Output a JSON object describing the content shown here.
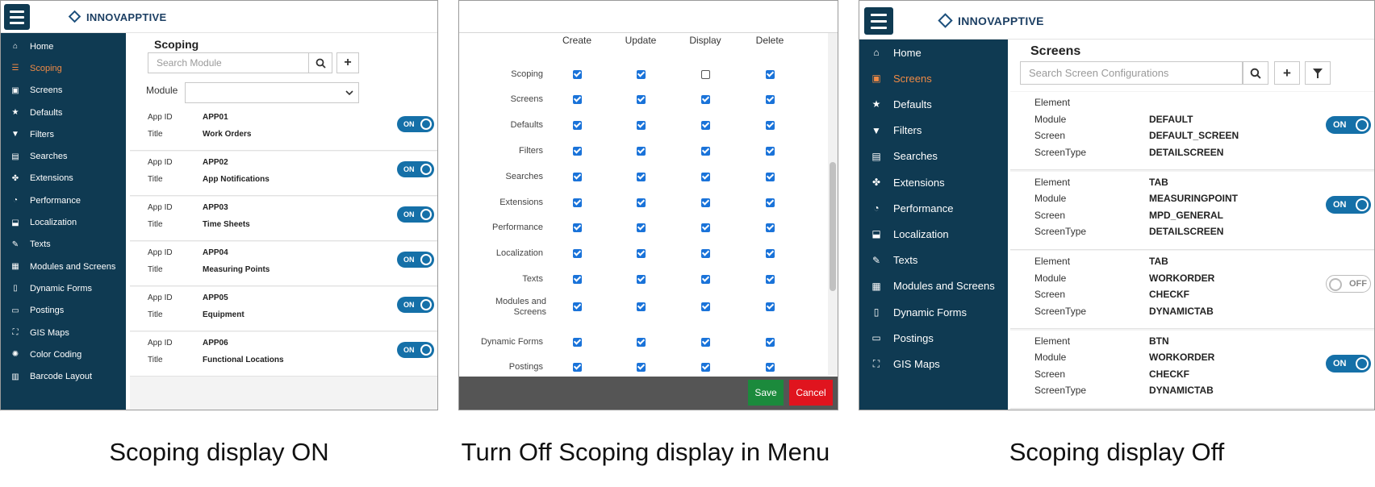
{
  "brand": "INNOVAPPTIVE",
  "colors": {
    "sidebar": "#0f3a52",
    "active": "#f08a45",
    "toggle_on": "#1570a8",
    "save": "#1b8a3c",
    "cancel": "#e0141e",
    "checkbox": "#1a73d9"
  },
  "left": {
    "nav": [
      {
        "icon": "home-icon",
        "glyph": "⌂",
        "label": "Home"
      },
      {
        "icon": "list-icon",
        "glyph": "☰",
        "label": "Scoping"
      },
      {
        "icon": "screen-icon",
        "glyph": "▣",
        "label": "Screens"
      },
      {
        "icon": "star-icon",
        "glyph": "★",
        "label": "Defaults"
      },
      {
        "icon": "filter-icon",
        "glyph": "▼",
        "label": "Filters"
      },
      {
        "icon": "search-box-icon",
        "glyph": "▤",
        "label": "Searches"
      },
      {
        "icon": "puzzle-icon",
        "glyph": "✤",
        "label": "Extensions"
      },
      {
        "icon": "gauge-icon",
        "glyph": "◔",
        "label": "Performance"
      },
      {
        "icon": "localize-icon",
        "glyph": "⬓",
        "label": "Localization"
      },
      {
        "icon": "pen-icon",
        "glyph": "✎",
        "label": "Texts"
      },
      {
        "icon": "grid-icon",
        "glyph": "▦",
        "label": "Modules and Screens"
      },
      {
        "icon": "doc-icon",
        "glyph": "▯",
        "label": "Dynamic Forms"
      },
      {
        "icon": "card-icon",
        "glyph": "▭",
        "label": "Postings"
      },
      {
        "icon": "map-icon",
        "glyph": "⛶",
        "label": "GIS Maps"
      },
      {
        "icon": "palette-icon",
        "glyph": "✺",
        "label": "Color Coding"
      },
      {
        "icon": "barcode-icon",
        "glyph": "▥",
        "label": "Barcode Layout"
      }
    ],
    "title": "Scoping",
    "search_placeholder": "Search Module",
    "module_label": "Module",
    "keys": {
      "id": "App ID",
      "title": "Title"
    },
    "apps": [
      {
        "id": "APP01",
        "title": "Work Orders",
        "toggle": "ON"
      },
      {
        "id": "APP02",
        "title": "App Notifications",
        "toggle": "ON"
      },
      {
        "id": "APP03",
        "title": "Time Sheets",
        "toggle": "ON"
      },
      {
        "id": "APP04",
        "title": "Measuring Points",
        "toggle": "ON"
      },
      {
        "id": "APP05",
        "title": "Equipment",
        "toggle": "ON"
      },
      {
        "id": "APP06",
        "title": "Functional Locations",
        "toggle": "ON"
      }
    ]
  },
  "middle": {
    "columns": [
      "Create",
      "Update",
      "Display",
      "Delete"
    ],
    "rows": [
      {
        "label": "Scoping",
        "checks": [
          true,
          true,
          false,
          true
        ]
      },
      {
        "label": "Screens",
        "checks": [
          true,
          true,
          true,
          true
        ]
      },
      {
        "label": "Defaults",
        "checks": [
          true,
          true,
          true,
          true
        ]
      },
      {
        "label": "Filters",
        "checks": [
          true,
          true,
          true,
          true
        ]
      },
      {
        "label": "Searches",
        "checks": [
          true,
          true,
          true,
          true
        ]
      },
      {
        "label": "Extensions",
        "checks": [
          true,
          true,
          true,
          true
        ]
      },
      {
        "label": "Performance",
        "checks": [
          true,
          true,
          true,
          true
        ]
      },
      {
        "label": "Localization",
        "checks": [
          true,
          true,
          true,
          true
        ]
      },
      {
        "label": "Texts",
        "checks": [
          true,
          true,
          true,
          true
        ]
      },
      {
        "label": "Modules and Screens",
        "checks": [
          true,
          true,
          true,
          true
        ]
      },
      {
        "label": "Dynamic Forms",
        "checks": [
          true,
          true,
          true,
          true
        ]
      },
      {
        "label": "Postings",
        "checks": [
          true,
          true,
          true,
          true
        ]
      }
    ],
    "save": "Save",
    "cancel": "Cancel"
  },
  "right": {
    "nav": [
      {
        "icon": "home-icon",
        "glyph": "⌂",
        "label": "Home"
      },
      {
        "icon": "screen-icon",
        "glyph": "▣",
        "label": "Screens"
      },
      {
        "icon": "star-icon",
        "glyph": "★",
        "label": "Defaults"
      },
      {
        "icon": "filter-icon",
        "glyph": "▼",
        "label": "Filters"
      },
      {
        "icon": "search-box-icon",
        "glyph": "▤",
        "label": "Searches"
      },
      {
        "icon": "puzzle-icon",
        "glyph": "✤",
        "label": "Extensions"
      },
      {
        "icon": "gauge-icon",
        "glyph": "◔",
        "label": "Performance"
      },
      {
        "icon": "localize-icon",
        "glyph": "⬓",
        "label": "Localization"
      },
      {
        "icon": "pen-icon",
        "glyph": "✎",
        "label": "Texts"
      },
      {
        "icon": "grid-icon",
        "glyph": "▦",
        "label": "Modules and Screens"
      },
      {
        "icon": "doc-icon",
        "glyph": "▯",
        "label": "Dynamic Forms"
      },
      {
        "icon": "card-icon",
        "glyph": "▭",
        "label": "Postings"
      },
      {
        "icon": "map-icon",
        "glyph": "⛶",
        "label": "GIS Maps"
      }
    ],
    "title": "Screens",
    "search_placeholder": "Search Screen Configurations",
    "keys": {
      "element": "Element",
      "module": "Module",
      "screen": "Screen",
      "screentype": "ScreenType"
    },
    "screens": [
      {
        "element": "",
        "module": "DEFAULT",
        "screen": "DEFAULT_SCREEN",
        "screentype": "DETAILSCREEN",
        "toggle": "ON",
        "on": true
      },
      {
        "element": "TAB",
        "module": "MEASURINGPOINT",
        "screen": "MPD_GENERAL",
        "screentype": "DETAILSCREEN",
        "toggle": "ON",
        "on": true
      },
      {
        "element": "TAB",
        "module": "WORKORDER",
        "screen": "CHECKF",
        "screentype": "DYNAMICTAB",
        "toggle": "OFF",
        "on": false
      },
      {
        "element": "BTN",
        "module": "WORKORDER",
        "screen": "CHECKF",
        "screentype": "DYNAMICTAB",
        "toggle": "ON",
        "on": true
      }
    ]
  },
  "captions": [
    "Scoping display ON",
    "Turn Off Scoping display in Menu",
    "Scoping display Off"
  ]
}
